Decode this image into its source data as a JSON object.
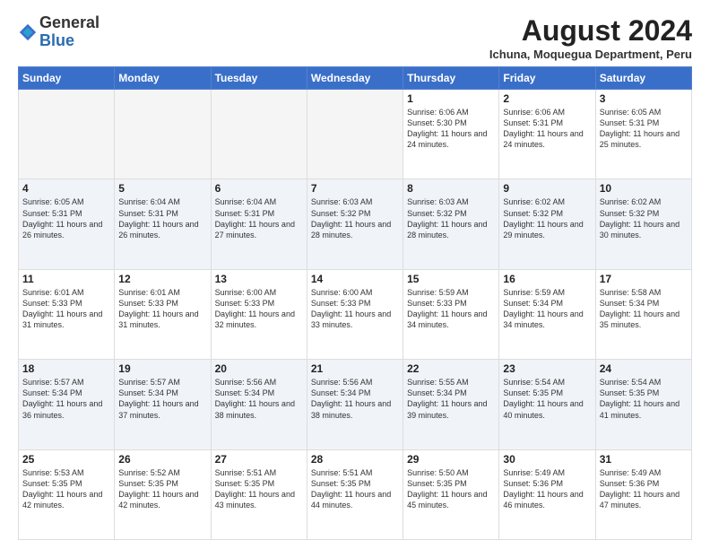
{
  "logo": {
    "general": "General",
    "blue": "Blue"
  },
  "header": {
    "month_year": "August 2024",
    "location": "Ichuna, Moquegua Department, Peru"
  },
  "days_of_week": [
    "Sunday",
    "Monday",
    "Tuesday",
    "Wednesday",
    "Thursday",
    "Friday",
    "Saturday"
  ],
  "weeks": [
    [
      {
        "day": "",
        "info": ""
      },
      {
        "day": "",
        "info": ""
      },
      {
        "day": "",
        "info": ""
      },
      {
        "day": "",
        "info": ""
      },
      {
        "day": "1",
        "info": "Sunrise: 6:06 AM\nSunset: 5:30 PM\nDaylight: 11 hours and 24 minutes."
      },
      {
        "day": "2",
        "info": "Sunrise: 6:06 AM\nSunset: 5:31 PM\nDaylight: 11 hours and 24 minutes."
      },
      {
        "day": "3",
        "info": "Sunrise: 6:05 AM\nSunset: 5:31 PM\nDaylight: 11 hours and 25 minutes."
      }
    ],
    [
      {
        "day": "4",
        "info": "Sunrise: 6:05 AM\nSunset: 5:31 PM\nDaylight: 11 hours and 26 minutes."
      },
      {
        "day": "5",
        "info": "Sunrise: 6:04 AM\nSunset: 5:31 PM\nDaylight: 11 hours and 26 minutes."
      },
      {
        "day": "6",
        "info": "Sunrise: 6:04 AM\nSunset: 5:31 PM\nDaylight: 11 hours and 27 minutes."
      },
      {
        "day": "7",
        "info": "Sunrise: 6:03 AM\nSunset: 5:32 PM\nDaylight: 11 hours and 28 minutes."
      },
      {
        "day": "8",
        "info": "Sunrise: 6:03 AM\nSunset: 5:32 PM\nDaylight: 11 hours and 28 minutes."
      },
      {
        "day": "9",
        "info": "Sunrise: 6:02 AM\nSunset: 5:32 PM\nDaylight: 11 hours and 29 minutes."
      },
      {
        "day": "10",
        "info": "Sunrise: 6:02 AM\nSunset: 5:32 PM\nDaylight: 11 hours and 30 minutes."
      }
    ],
    [
      {
        "day": "11",
        "info": "Sunrise: 6:01 AM\nSunset: 5:33 PM\nDaylight: 11 hours and 31 minutes."
      },
      {
        "day": "12",
        "info": "Sunrise: 6:01 AM\nSunset: 5:33 PM\nDaylight: 11 hours and 31 minutes."
      },
      {
        "day": "13",
        "info": "Sunrise: 6:00 AM\nSunset: 5:33 PM\nDaylight: 11 hours and 32 minutes."
      },
      {
        "day": "14",
        "info": "Sunrise: 6:00 AM\nSunset: 5:33 PM\nDaylight: 11 hours and 33 minutes."
      },
      {
        "day": "15",
        "info": "Sunrise: 5:59 AM\nSunset: 5:33 PM\nDaylight: 11 hours and 34 minutes."
      },
      {
        "day": "16",
        "info": "Sunrise: 5:59 AM\nSunset: 5:34 PM\nDaylight: 11 hours and 34 minutes."
      },
      {
        "day": "17",
        "info": "Sunrise: 5:58 AM\nSunset: 5:34 PM\nDaylight: 11 hours and 35 minutes."
      }
    ],
    [
      {
        "day": "18",
        "info": "Sunrise: 5:57 AM\nSunset: 5:34 PM\nDaylight: 11 hours and 36 minutes."
      },
      {
        "day": "19",
        "info": "Sunrise: 5:57 AM\nSunset: 5:34 PM\nDaylight: 11 hours and 37 minutes."
      },
      {
        "day": "20",
        "info": "Sunrise: 5:56 AM\nSunset: 5:34 PM\nDaylight: 11 hours and 38 minutes."
      },
      {
        "day": "21",
        "info": "Sunrise: 5:56 AM\nSunset: 5:34 PM\nDaylight: 11 hours and 38 minutes."
      },
      {
        "day": "22",
        "info": "Sunrise: 5:55 AM\nSunset: 5:34 PM\nDaylight: 11 hours and 39 minutes."
      },
      {
        "day": "23",
        "info": "Sunrise: 5:54 AM\nSunset: 5:35 PM\nDaylight: 11 hours and 40 minutes."
      },
      {
        "day": "24",
        "info": "Sunrise: 5:54 AM\nSunset: 5:35 PM\nDaylight: 11 hours and 41 minutes."
      }
    ],
    [
      {
        "day": "25",
        "info": "Sunrise: 5:53 AM\nSunset: 5:35 PM\nDaylight: 11 hours and 42 minutes."
      },
      {
        "day": "26",
        "info": "Sunrise: 5:52 AM\nSunset: 5:35 PM\nDaylight: 11 hours and 42 minutes."
      },
      {
        "day": "27",
        "info": "Sunrise: 5:51 AM\nSunset: 5:35 PM\nDaylight: 11 hours and 43 minutes."
      },
      {
        "day": "28",
        "info": "Sunrise: 5:51 AM\nSunset: 5:35 PM\nDaylight: 11 hours and 44 minutes."
      },
      {
        "day": "29",
        "info": "Sunrise: 5:50 AM\nSunset: 5:35 PM\nDaylight: 11 hours and 45 minutes."
      },
      {
        "day": "30",
        "info": "Sunrise: 5:49 AM\nSunset: 5:36 PM\nDaylight: 11 hours and 46 minutes."
      },
      {
        "day": "31",
        "info": "Sunrise: 5:49 AM\nSunset: 5:36 PM\nDaylight: 11 hours and 47 minutes."
      }
    ]
  ]
}
